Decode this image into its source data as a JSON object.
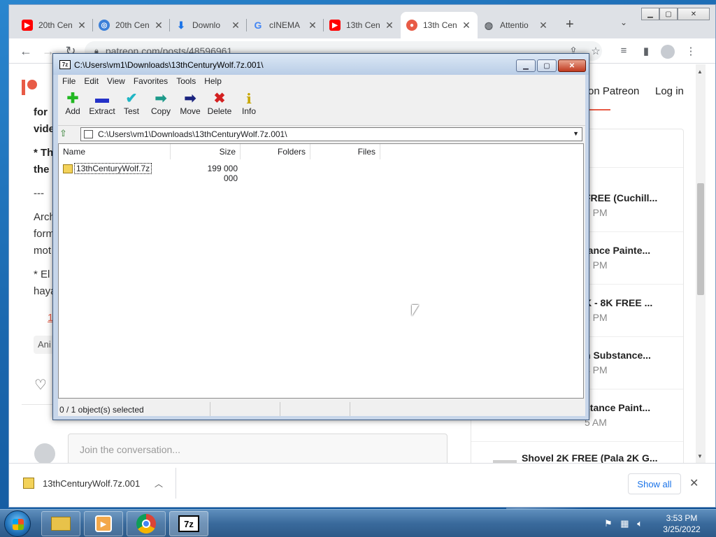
{
  "browser": {
    "tabs": [
      {
        "title": "20th Cen",
        "favicon": "youtube-icon",
        "color": "#ff0000"
      },
      {
        "title": "20th Cen",
        "favicon": "blue-circle-icon",
        "color": "#3b7fd8"
      },
      {
        "title": "Downlo",
        "favicon": "download-icon",
        "color": "#1a73e8"
      },
      {
        "title": "cINEMA",
        "favicon": "google-icon",
        "color": "#4285f4"
      },
      {
        "title": "13th Cen",
        "favicon": "youtube-icon",
        "color": "#ff0000"
      },
      {
        "title": "13th Cen",
        "favicon": "patreon-icon",
        "color": "#e85b46"
      },
      {
        "title": "Attentio",
        "favicon": "globe-icon",
        "color": "#5f6368"
      }
    ],
    "url": "patreon.com/posts/48596961",
    "page": {
      "on_patreon": "on Patreon",
      "login": "Log in",
      "post_lines": [
        {
          "text": "for",
          "bold": true
        },
        {
          "text": "vide",
          "bold": true
        },
        {
          "text": "* Th",
          "bold": true
        },
        {
          "text": "the",
          "bold": true
        },
        {
          "text": "---",
          "bold": false
        },
        {
          "text": "Arch",
          "bold": false
        },
        {
          "text": "form",
          "bold": false
        },
        {
          "text": "mot",
          "bold": false
        },
        {
          "text": "* El",
          "bold": false
        },
        {
          "text": "haya",
          "bold": false
        },
        {
          "text": "1",
          "bold": false
        }
      ],
      "tag": "Ani",
      "comment_placeholder": "Join the conversation...",
      "side_posts": [
        {
          "title": "FREE (Cuchill...",
          "time": "7 PM"
        },
        {
          "title": "tance Painte...",
          "time": "2 PM"
        },
        {
          "title": "K - 8K FREE ...",
          "time": "1 PM"
        },
        {
          "title": "n Substance...",
          "time": "4 PM"
        },
        {
          "title": "stance Paint...",
          "time": "5 AM"
        }
      ],
      "last_post_title": "Shovel 2K FREE (Pala 2K G..."
    },
    "downloads": {
      "file": "13thCenturyWolf.7z.001",
      "show_all": "Show all"
    }
  },
  "zip": {
    "title": "C:\\Users\\vm1\\Downloads\\13thCenturyWolf.7z.001\\",
    "title_icon": "7z",
    "menu": [
      "File",
      "Edit",
      "View",
      "Favorites",
      "Tools",
      "Help"
    ],
    "tools": [
      {
        "label": "Add",
        "icon": "plus-icon",
        "glyph": "✚",
        "color": "#22b822"
      },
      {
        "label": "Extract",
        "icon": "minus-icon",
        "glyph": "▬",
        "color": "#2432c8"
      },
      {
        "label": "Test",
        "icon": "check-icon",
        "glyph": "✔",
        "color": "#1fb5c4"
      },
      {
        "label": "Copy",
        "icon": "copy-arrow-icon",
        "glyph": "➡",
        "color": "#1e9a8a"
      },
      {
        "label": "Move",
        "icon": "move-arrow-icon",
        "glyph": "➡",
        "color": "#1a237e"
      },
      {
        "label": "Delete",
        "icon": "delete-x-icon",
        "glyph": "✖",
        "color": "#d32020"
      },
      {
        "label": "Info",
        "icon": "info-icon",
        "glyph": "i",
        "color": "#c7a600"
      }
    ],
    "address": "C:\\Users\\vm1\\Downloads\\13thCenturyWolf.7z.001\\",
    "columns": [
      "Name",
      "Size",
      "Folders",
      "Files"
    ],
    "rows": [
      {
        "name": "13thCenturyWolf.7z",
        "size": "199 000 000"
      }
    ],
    "status": "0 / 1 object(s) selected"
  },
  "taskbar": {
    "time": "3:53 PM",
    "date": "3/25/2022",
    "zip_label": "7z"
  }
}
